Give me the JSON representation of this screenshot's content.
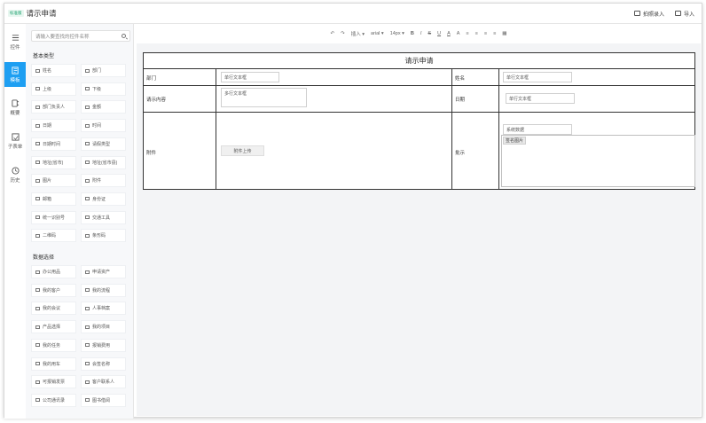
{
  "header": {
    "badge": "标准版",
    "title": "请示申请",
    "actions": [
      {
        "label": "拍照录入"
      },
      {
        "label": "导入"
      }
    ]
  },
  "rail": [
    {
      "label": "控件",
      "icon": "menu-icon",
      "active": false
    },
    {
      "label": "模板",
      "icon": "template-icon",
      "active": true
    },
    {
      "label": "概要",
      "icon": "outline-icon",
      "active": false
    },
    {
      "label": "子表单",
      "icon": "subform-icon",
      "active": false
    },
    {
      "label": "历史",
      "icon": "history-icon",
      "active": false
    }
  ],
  "palette": {
    "search_placeholder": "请输入要查找的控件名称",
    "basic_title": "基本类型",
    "basic": [
      "姓名",
      "部门",
      "上级",
      "下级",
      "部门负责人",
      "金额",
      "日期",
      "时间",
      "日期时间",
      "请假类型",
      "地址(省市)",
      "地址(省市县)",
      "图片",
      "附件",
      "邮箱",
      "身份证",
      "统一识别号",
      "交通工具",
      "二维码",
      "条形码"
    ],
    "data_title": "数据选择",
    "data": [
      "办公用品",
      "申请资产",
      "我的客户",
      "我的流程",
      "我的会议",
      "人事档案",
      "产品选择",
      "我的项目",
      "我的任务",
      "报销费用",
      "我的用车",
      "会签名称",
      "可报销发票",
      "客户联系人",
      "公司通讯录",
      "图书借阅"
    ]
  },
  "toolbar": {
    "undo": "↶",
    "redo": "↷",
    "insert": "插入 ▾",
    "font": "arial ▾",
    "size": "14px ▾",
    "bold": "B",
    "italic": "I",
    "strike": "S",
    "underline": "U",
    "font_color": "A",
    "bg_color": "A",
    "align_left": "≡",
    "align_center": "≡",
    "align_right": "≡",
    "justify": "≡",
    "table": "▦"
  },
  "form": {
    "title": "请示申请",
    "row1": {
      "label_left": "部门",
      "value_left": "单行文本框",
      "label_right": "姓名",
      "value_right": "单行文本框"
    },
    "row2": {
      "label_left": "请示内容",
      "value_left": "多行文本框",
      "label_right": "日期",
      "value_right": "单行文本框"
    },
    "row3": {
      "label_left": "附件",
      "upload_label": "附件上传",
      "label_right": "批示",
      "system_field": "系统数据",
      "signature_label": "签名图片"
    }
  }
}
